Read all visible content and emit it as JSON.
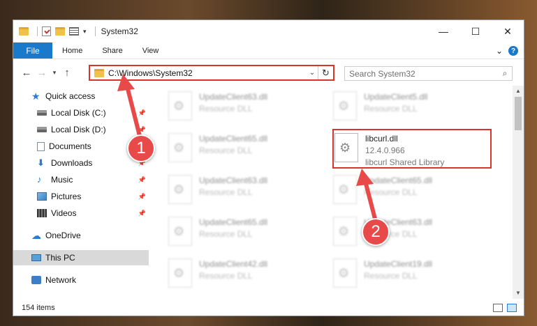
{
  "window": {
    "title": "System32",
    "controls": {
      "minimize": "—",
      "maximize": "☐",
      "close": "✕"
    }
  },
  "ribbon": {
    "file": "File",
    "tabs": [
      "Home",
      "Share",
      "View"
    ],
    "expand": "⌄",
    "help": "?"
  },
  "address": {
    "path": "C:\\Windows\\System32",
    "search_placeholder": "Search System32"
  },
  "nav": {
    "quick_access": "Quick access",
    "items": [
      {
        "label": "Local Disk (C:)",
        "icon": "drive-icon"
      },
      {
        "label": "Local Disk (D:)",
        "icon": "drive-icon"
      },
      {
        "label": "Documents",
        "icon": "document-icon"
      },
      {
        "label": "Downloads",
        "icon": "download-icon"
      },
      {
        "label": "Music",
        "icon": "music-icon"
      },
      {
        "label": "Pictures",
        "icon": "pictures-icon"
      },
      {
        "label": "Videos",
        "icon": "videos-icon"
      }
    ],
    "onedrive": "OneDrive",
    "this_pc": "This PC",
    "network": "Network"
  },
  "files": {
    "blurred": [
      {
        "name": "UpdateClient63.dll",
        "type": "Resource DLL"
      },
      {
        "name": "UpdateClient5.dll",
        "type": "Resource DLL"
      },
      {
        "name": "UpdateClient65.dll",
        "type": "Resource DLL"
      },
      {
        "name": "UpdateClient63.dll",
        "type": "Resource DLL"
      },
      {
        "name": "UpdateClient65.dll",
        "type": "Resource DLL"
      },
      {
        "name": "UpdateClient65.dll",
        "type": "Resource DLL"
      },
      {
        "name": "UpdateClient63.dll",
        "type": "Resource DLL"
      },
      {
        "name": "UpdateClient42.dll",
        "type": "Resource DLL"
      },
      {
        "name": "UpdateClient19.dll",
        "type": "Resource DLL"
      }
    ],
    "highlighted": {
      "name": "libcurl.dll",
      "version": "12.4.0.966",
      "description": "libcurl Shared Library"
    }
  },
  "status": {
    "count": "154 items"
  },
  "annotations": {
    "step1": "1",
    "step2": "2",
    "color": "#e84a4a"
  }
}
